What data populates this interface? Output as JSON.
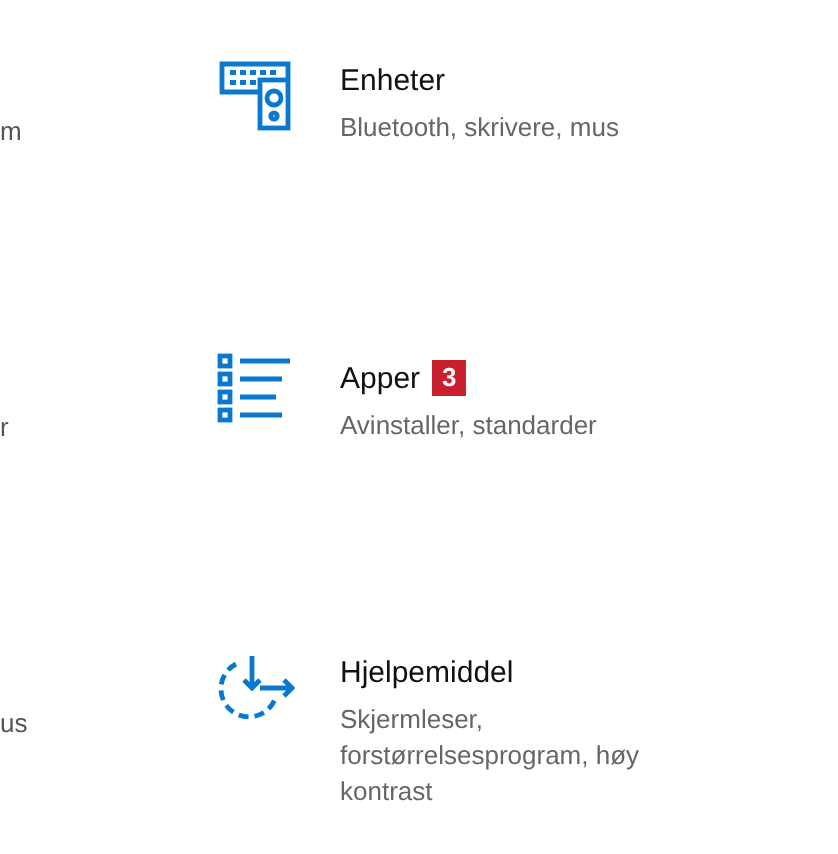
{
  "tiles": [
    {
      "kind": "devices",
      "left_fragment": "m",
      "title": "Enheter",
      "subtitle": "Bluetooth, skrivere, mus"
    },
    {
      "kind": "apps",
      "left_fragment": "r",
      "title": "Apper",
      "badge": "3",
      "subtitle": "Avinstaller, standarder"
    },
    {
      "kind": "accessibility",
      "left_fragment": "us",
      "title": "Hjelpemiddel",
      "subtitle": "Skjermleser, forstørrelsesprogram, høy kontrast"
    }
  ]
}
